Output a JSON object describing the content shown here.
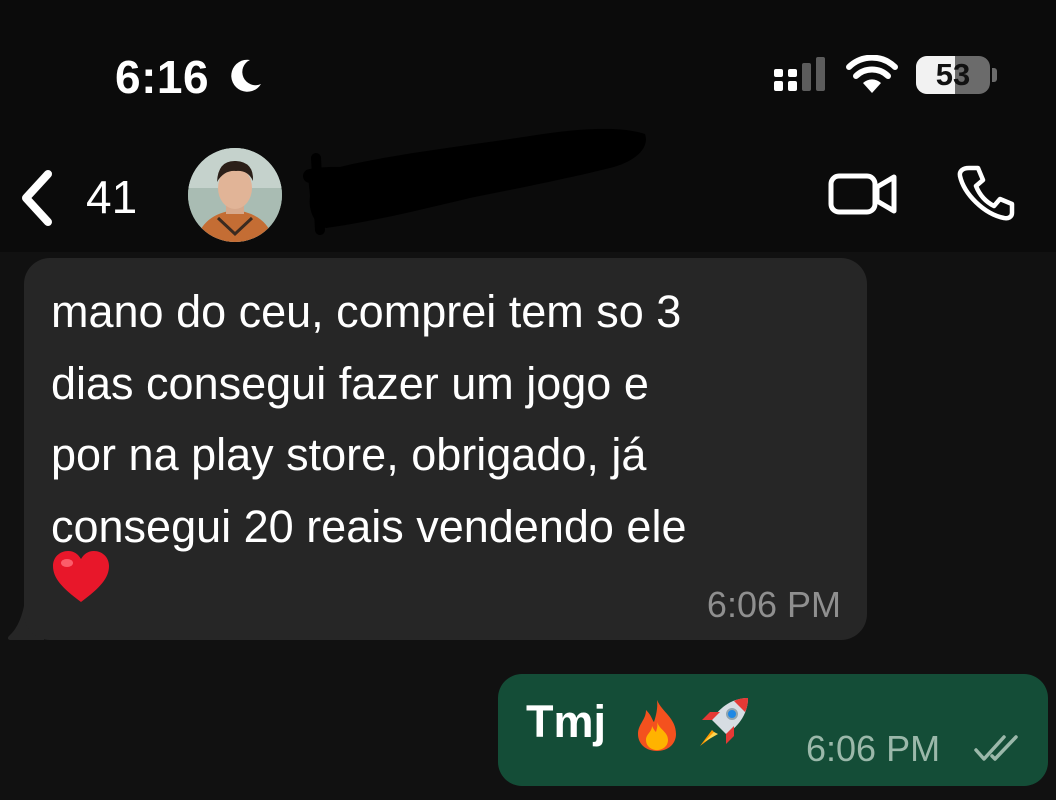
{
  "status_bar": {
    "time": "6:16",
    "battery_level": 53,
    "battery_text": "53",
    "icons": [
      "moon-icon",
      "cellular-signal-icon",
      "wifi-icon",
      "battery-icon"
    ]
  },
  "header": {
    "unread_count": "41",
    "icons": [
      "back-chevron-icon",
      "video-call-icon",
      "phone-icon"
    ]
  },
  "messages": [
    {
      "direction": "incoming",
      "text": "mano do ceu, comprei tem so 3\ndias consegui fazer um jogo e\npor na play store, obrigado, já\nconsegui 20 reais vendendo ele",
      "emoji": "heart-emoji",
      "time": "6:06 PM"
    },
    {
      "direction": "outgoing",
      "text": "Tmj",
      "emojis": [
        "fire-emoji",
        "rocket-emoji"
      ],
      "time": "6:06 PM",
      "status": "read"
    }
  ],
  "colors": {
    "background": "#111111",
    "incoming_bubble": "#262626",
    "outgoing_bubble": "#144d37",
    "timestamp_in": "#8f8f8f",
    "timestamp_out": "#9bb8aa"
  }
}
